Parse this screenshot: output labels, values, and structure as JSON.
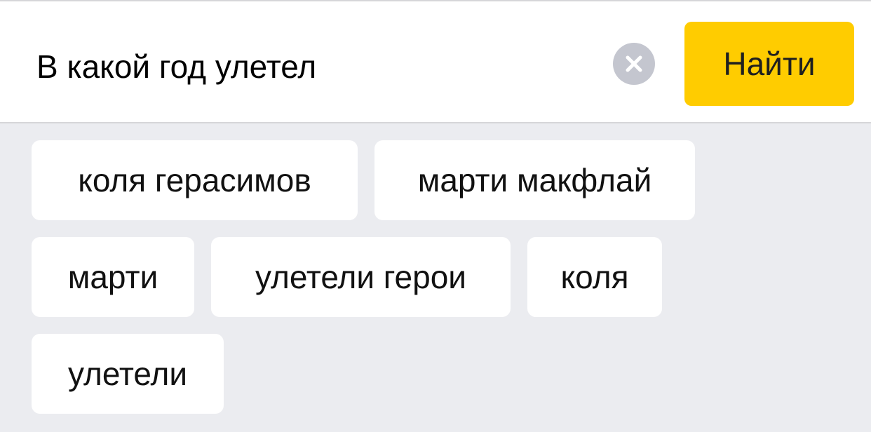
{
  "search": {
    "query": "В какой год улетел",
    "clear_icon": "close-icon",
    "find_label": "Найти"
  },
  "suggestions": [
    {
      "label": "коля герасимов"
    },
    {
      "label": "марти макфлай"
    },
    {
      "label": "марти"
    },
    {
      "label": "улетели герои"
    },
    {
      "label": "коля"
    },
    {
      "label": "улетели"
    }
  ],
  "colors": {
    "accent": "#ffcc00",
    "background": "#ebecf0",
    "chip": "#ffffff",
    "clear_icon_bg": "#c4c6cf"
  }
}
